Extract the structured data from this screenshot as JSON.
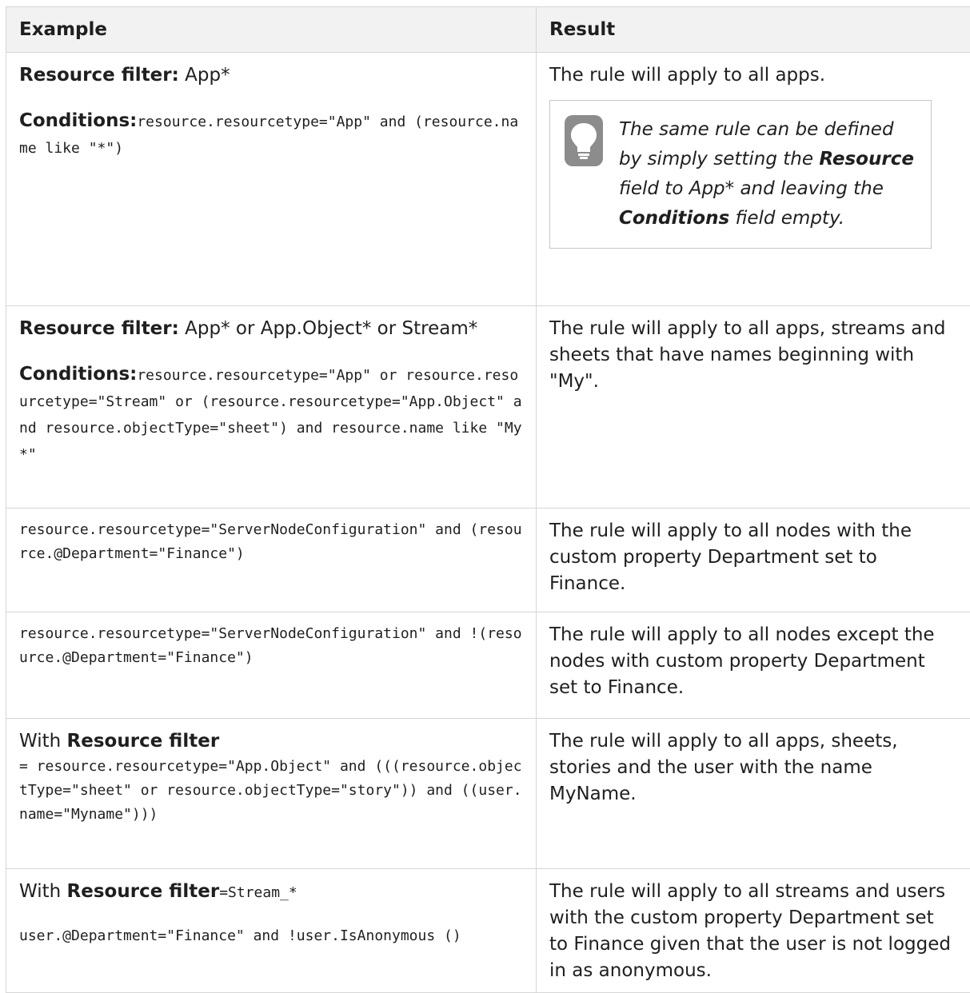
{
  "header": {
    "example": "Example",
    "result": "Result"
  },
  "rows": [
    {
      "rf_label": "Resource filter:",
      "rf_value": "App*",
      "cond_label": "Conditions:",
      "cond_code": "resource.resourcetype=\"App\" and (resource.name like \"*\")",
      "result": "The rule will apply to all apps.",
      "tip": {
        "t1": "The same rule can be defined by simply setting the ",
        "b1": "Resource",
        "t2": " field to App* and leaving the ",
        "b2": "Conditions",
        "t3": " field empty."
      }
    },
    {
      "rf_label": "Resource filter:",
      "rf_value": "App* or App.Object* or Stream*",
      "cond_label": "Conditions:",
      "cond_code": "resource.resourcetype=\"App\" or resource.resourcetype=\"Stream\" or (resource.resourcetype=\"App.Object\" and resource.objectType=\"sheet\") and resource.name like \"My*\"",
      "result": "The rule will apply to all apps, streams and sheets that have names beginning with \"My\"."
    },
    {
      "code": "resource.resourcetype=\"ServerNodeConfiguration\" and (resource.@Department=\"Finance\")",
      "result": "The rule will apply to all nodes with the custom property Department set to Finance."
    },
    {
      "code": "resource.resourcetype=\"ServerNodeConfiguration\" and !(resource.@Department=\"Finance\")",
      "result": "The rule will apply to all nodes except the nodes with custom property Department set to Finance."
    },
    {
      "with": "With ",
      "rf_bold": "Resource filter",
      "code": "= resource.resourcetype=\"App.Object\" and (((resource.objectType=\"sheet\" or resource.objectType=\"story\")) and ((user.name=\"Myname\")))",
      "result": "The rule will apply to all apps, sheets, stories and the user with the name MyName."
    },
    {
      "with": "With ",
      "rf_bold": "Resource filter",
      "rf_code": "=Stream_*",
      "code": "user.@Department=\"Finance\" and !user.IsAnonymous ()",
      "result": "The rule will apply to all streams and users with the custom property Department set to Finance given that the user is not logged in as anonymous."
    }
  ],
  "icons": {
    "tip": "lightbulb-icon"
  },
  "colors": {
    "header_bg": "#f2f2f2",
    "border": "#d6d6d6",
    "tip_icon": "#8c8c8c"
  }
}
